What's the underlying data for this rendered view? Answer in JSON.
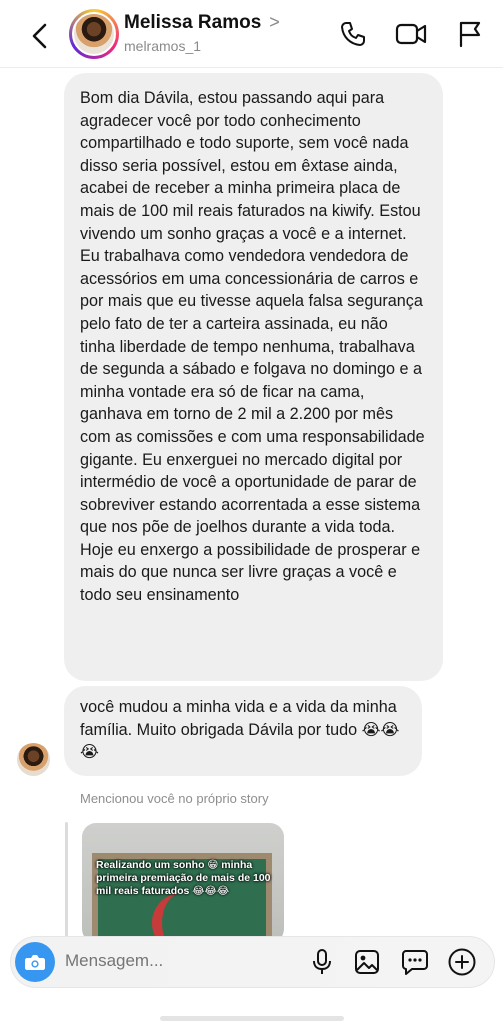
{
  "header": {
    "name": "Melissa Ramos",
    "username": "melramos_1",
    "chevron": ">"
  },
  "icons": {
    "back": "chevron-left-icon",
    "call": "phone-icon",
    "video": "video-camera-icon",
    "flag": "flag-icon",
    "camera": "camera-icon",
    "mic": "microphone-icon",
    "gallery": "image-icon",
    "sticker": "chat-bubble-icon",
    "plus": "plus-icon"
  },
  "messages": [
    {
      "text": "Bom dia Dávila, estou passando aqui para agradecer você por todo conhecimento compartilhado e todo suporte, sem você nada disso seria possível, estou em êxtase ainda, acabei de receber a minha primeira placa de mais de 100 mil reais faturados na kiwify. Estou vivendo um sonho graças a você e a internet. Eu trabalhava como vendedora vendedora de acessórios em uma concessionária de carros e por mais que eu tivesse aquela falsa segurança pelo fato de ter a carteira assinada, eu não tinha liberdade de tempo nenhuma, trabalhava de segunda a sábado e folgava no domingo e a minha vontade era só de ficar na cama, ganhava em torno de 2 mil a 2.200 por mês com as comissões e com uma responsabilidade gigante. Eu enxerguei no mercado digital por intermédio de você a oportunidade de parar de sobreviver estando acorrentada a esse sistema que nos põe de joelhos durante a vida toda. Hoje eu enxergo a possibilidade de prosperar e mais do que nunca ser livre graças a você e todo seu ensinamento"
    },
    {
      "text": "você mudou a minha vida e a vida da minha família. Muito obrigada Dávila por tudo 😭😭😭"
    }
  ],
  "story_mention": {
    "label": "Mencionou você no próprio story",
    "caption": "Realizando um sonho 😁 minha primeira premiação de mais de 100 mil reais faturados 😂😂😂"
  },
  "composer": {
    "placeholder": "Mensagem..."
  },
  "colors": {
    "accent": "#3797f0",
    "bubble": "#efefef"
  }
}
